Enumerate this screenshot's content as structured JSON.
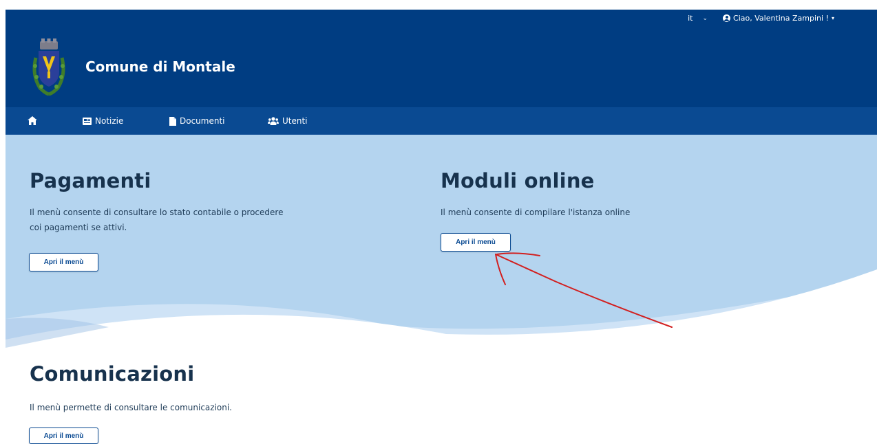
{
  "header": {
    "language": "it",
    "greeting": "Ciao, Valentina Zampini !",
    "site_title": "Comune di Montale",
    "background_color": "#003d82"
  },
  "nav": {
    "home_icon": "home-icon",
    "items": [
      {
        "icon": "newspaper-icon",
        "label": "Notizie"
      },
      {
        "icon": "document-icon",
        "label": "Documenti"
      },
      {
        "icon": "users-icon",
        "label": "Utenti"
      }
    ],
    "background_color": "#0a4a92"
  },
  "sections": [
    {
      "title": "Pagamenti",
      "description_line1": "Il menù consente di consultare lo stato contabile o procedere",
      "description_line2": "coi pagamenti se attivi.",
      "button_label": "Apri il menù"
    },
    {
      "title": "Moduli online",
      "description_line1": "Il menù consente di compilare l'istanza online",
      "button_label": "Apri il menù"
    },
    {
      "title": "Comunicazioni",
      "description_line1": "Il menù permette di consultare le comunicazioni.",
      "button_label": "Apri il menù"
    }
  ],
  "annotation": {
    "type": "hand-drawn-arrow",
    "color": "#d21f1f",
    "points_to": "Moduli online button"
  },
  "colors": {
    "hero_light_blue": "#b4d4ef",
    "title_dark": "#17324d",
    "accent_blue": "#0a4a92"
  }
}
